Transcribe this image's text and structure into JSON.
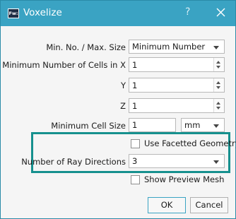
{
  "window": {
    "title": "Voxelize",
    "app_icon_text": "Fw:",
    "help_label": "?",
    "close_label": "×"
  },
  "form": {
    "min_max_label": "Min. No. / Max. Size",
    "min_max_value": "Minimum Number",
    "min_cells_x_label": "Minimum Number of Cells in X",
    "min_cells_x_value": "1",
    "y_label": "Y",
    "y_value": "1",
    "z_label": "Z",
    "z_value": "1",
    "min_cell_size_label": "Minimum Cell Size",
    "min_cell_size_value": "1",
    "unit_value": "mm",
    "use_faceted_label": "Use Facetted Geometry",
    "use_faceted_checked": false,
    "ray_directions_label": "Number of Ray Directions",
    "ray_directions_value": "3",
    "show_preview_label": "Show Preview Mesh",
    "show_preview_checked": false
  },
  "buttons": {
    "ok_label": "OK",
    "cancel_label": "Cancel"
  },
  "colors": {
    "titlebar": "#3aa3c3",
    "highlight": "#16908e"
  }
}
